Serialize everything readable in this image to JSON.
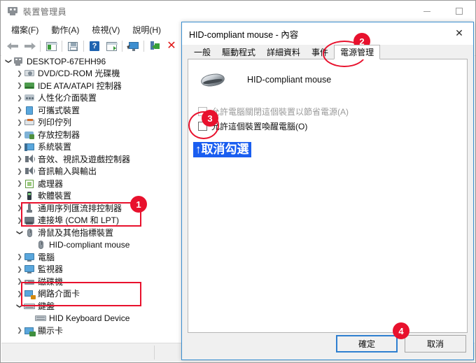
{
  "window": {
    "title": "裝置管理員",
    "title_icon": "device-manager-icon",
    "minimize": "−",
    "maximize": "□"
  },
  "menu": [
    {
      "label": "檔案(F)"
    },
    {
      "label": "動作(A)"
    },
    {
      "label": "檢視(V)"
    },
    {
      "label": "說明(H)"
    }
  ],
  "toolbar": [
    {
      "icon": "back-arrow-icon"
    },
    {
      "icon": "forward-arrow-icon"
    },
    {
      "icon": "properties-panel-icon"
    },
    {
      "icon": "save-icon"
    },
    {
      "icon": "help-icon"
    },
    {
      "icon": "update-driver-icon"
    },
    {
      "icon": "scan-hardware-icon"
    },
    {
      "icon": "disable-device-icon"
    },
    {
      "icon": "uninstall-device-icon"
    },
    {
      "icon": "download-icon"
    }
  ],
  "tree": [
    {
      "label": "DESKTOP-67EHH96",
      "indent": 0,
      "chevron": "open",
      "icon": "computer-icon"
    },
    {
      "label": "DVD/CD-ROM 光碟機",
      "indent": 1,
      "chevron": "closed",
      "icon": "dvd-icon"
    },
    {
      "label": "IDE ATA/ATAPI 控制器",
      "indent": 1,
      "chevron": "closed",
      "icon": "ide-icon"
    },
    {
      "label": "人性化介面裝置",
      "indent": 1,
      "chevron": "closed",
      "icon": "hid-icon"
    },
    {
      "label": "可攜式裝置",
      "indent": 1,
      "chevron": "closed",
      "icon": "portable-icon"
    },
    {
      "label": "列印佇列",
      "indent": 1,
      "chevron": "closed",
      "icon": "printer-icon"
    },
    {
      "label": "存放控制器",
      "indent": 1,
      "chevron": "closed",
      "icon": "storage-icon"
    },
    {
      "label": "系統裝置",
      "indent": 1,
      "chevron": "closed",
      "icon": "system-icon"
    },
    {
      "label": "音效、視訊及遊戲控制器",
      "indent": 1,
      "chevron": "closed",
      "icon": "sound-icon"
    },
    {
      "label": "音訊輸入與輸出",
      "indent": 1,
      "chevron": "closed",
      "icon": "sound-icon"
    },
    {
      "label": "處理器",
      "indent": 1,
      "chevron": "closed",
      "icon": "cpu-icon"
    },
    {
      "label": "軟體裝置",
      "indent": 1,
      "chevron": "closed",
      "icon": "software-icon"
    },
    {
      "label": "通用序列匯流排控制器",
      "indent": 1,
      "chevron": "closed",
      "icon": "usb-icon"
    },
    {
      "label": "連接埠 (COM 和 LPT)",
      "indent": 1,
      "chevron": "closed",
      "icon": "com-port-icon"
    },
    {
      "label": "滑鼠及其他指標裝置",
      "indent": 1,
      "chevron": "open",
      "icon": "mouse-icon"
    },
    {
      "label": "HID-compliant mouse",
      "indent": 2,
      "chevron": "none",
      "icon": "mouse-icon"
    },
    {
      "label": "電腦",
      "indent": 1,
      "chevron": "closed",
      "icon": "monitor-icon"
    },
    {
      "label": "監視器",
      "indent": 1,
      "chevron": "closed",
      "icon": "monitor-icon"
    },
    {
      "label": "磁碟機",
      "indent": 1,
      "chevron": "closed",
      "icon": "disk-drive-icon"
    },
    {
      "label": "網路介面卡",
      "indent": 1,
      "chevron": "closed",
      "icon": "network-icon"
    },
    {
      "label": "鍵盤",
      "indent": 1,
      "chevron": "open",
      "icon": "keyboard-icon"
    },
    {
      "label": "HID Keyboard Device",
      "indent": 2,
      "chevron": "none",
      "icon": "keyboard-icon"
    },
    {
      "label": "顯示卡",
      "indent": 1,
      "chevron": "closed",
      "icon": "display-adapter-icon"
    }
  ],
  "dialog": {
    "title": "HID-compliant mouse - 內容",
    "close_icon": "close-icon",
    "tabs": [
      {
        "label": "一般",
        "active": false
      },
      {
        "label": "驅動程式",
        "active": false
      },
      {
        "label": "詳細資料",
        "active": false
      },
      {
        "label": "事件",
        "active": false
      },
      {
        "label": "電源管理",
        "active": true
      }
    ],
    "device_name": "HID-compliant mouse",
    "device_icon": "mouse-icon",
    "checkboxes": [
      {
        "label": "允許電腦關閉這個裝置以節省電源(A)",
        "checked": false,
        "disabled": true
      },
      {
        "label": "允許這個裝置喚醒電腦(O)",
        "checked": false,
        "disabled": false
      }
    ],
    "buttons": {
      "ok": "確定",
      "cancel": "取消"
    }
  },
  "annotations": {
    "badges": [
      {
        "number": "1"
      },
      {
        "number": "2"
      },
      {
        "number": "3"
      },
      {
        "number": "4"
      }
    ],
    "blue_note": "↑取消勾選",
    "accent_red": "#e8112d",
    "accent_blue": "#1a5ef0"
  }
}
